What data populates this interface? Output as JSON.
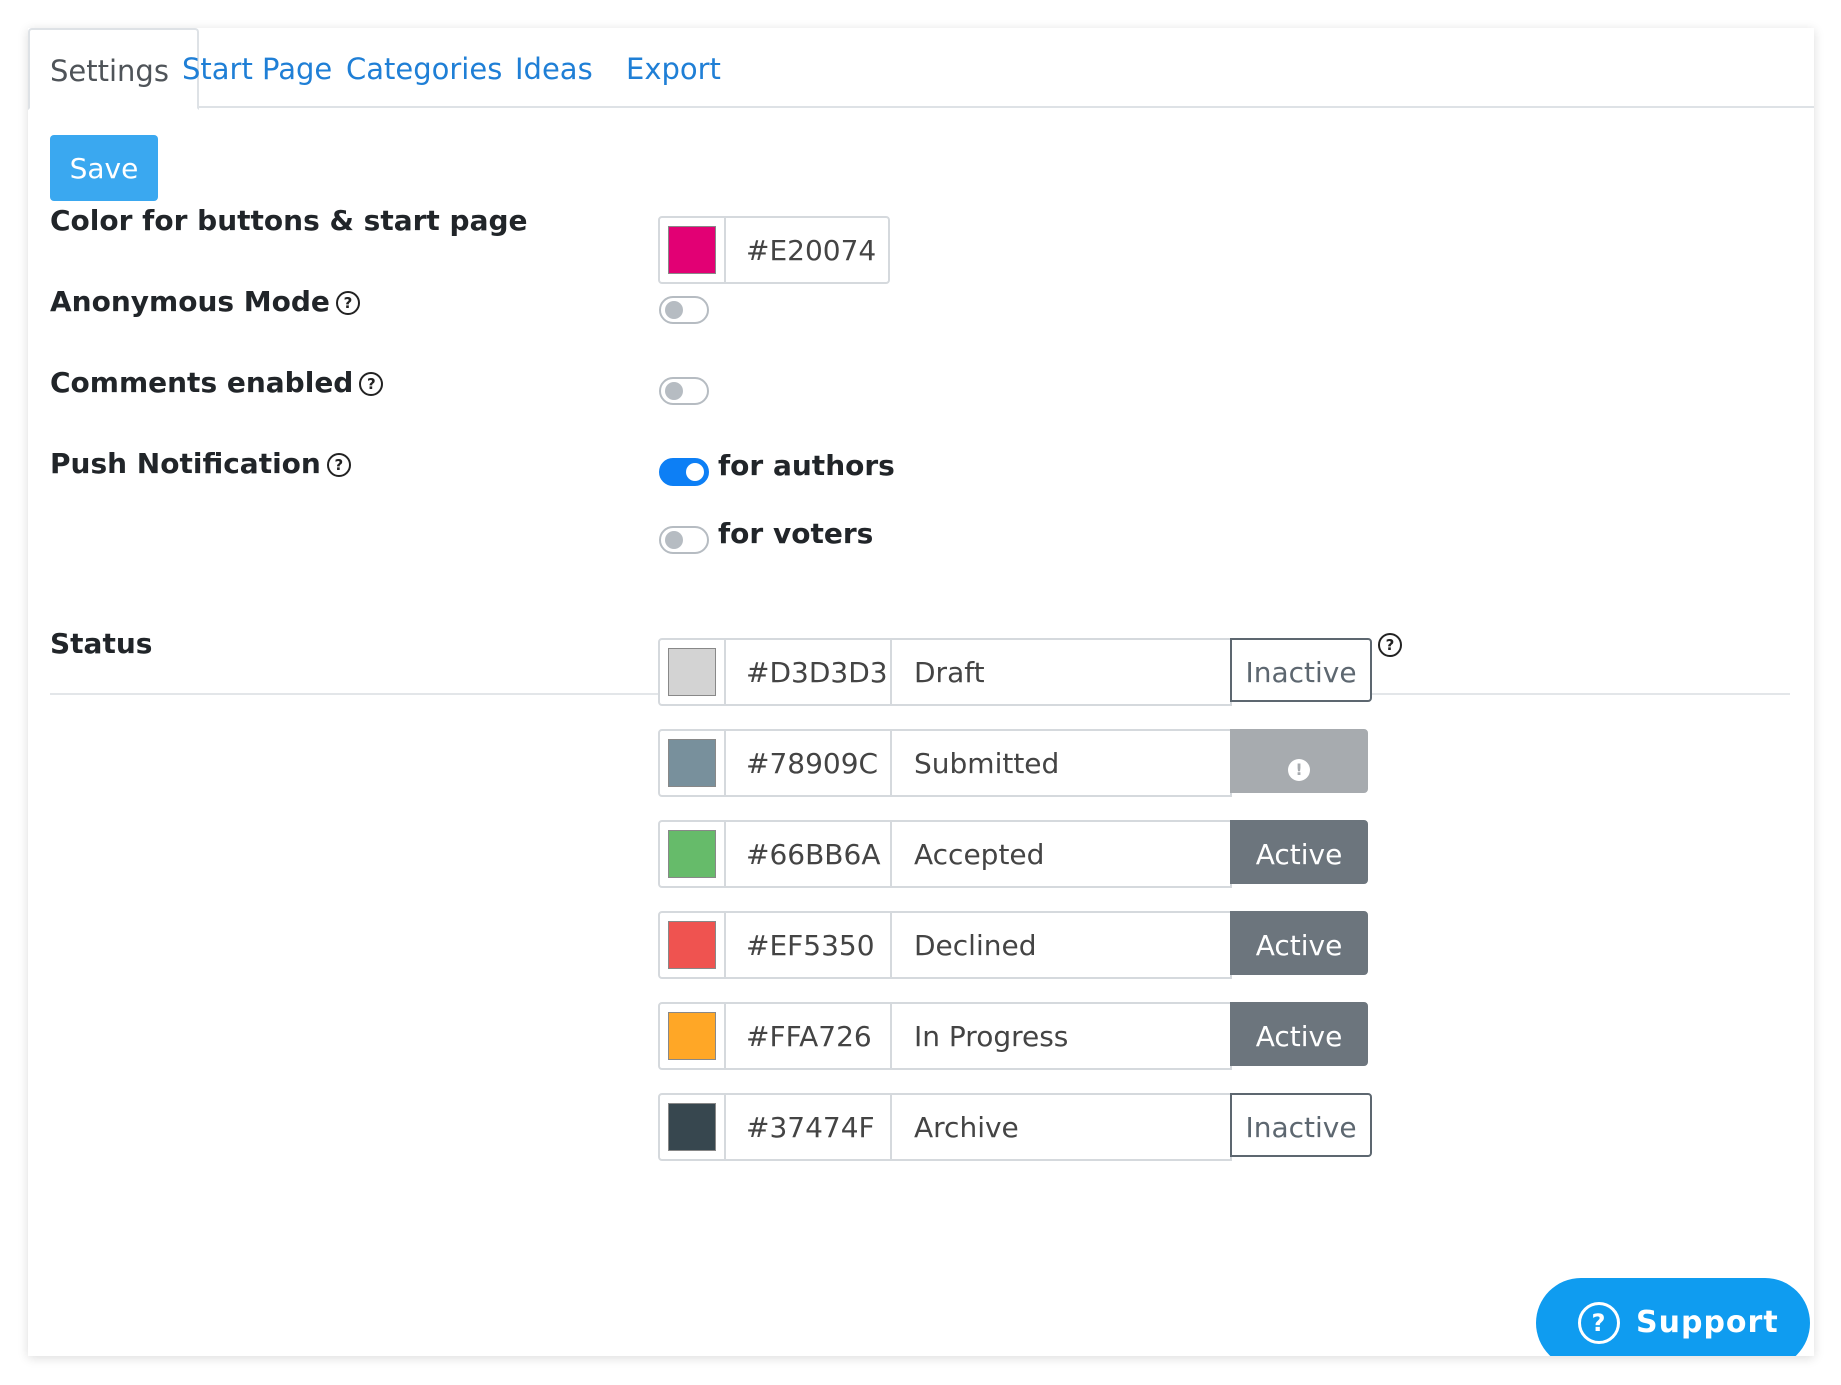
{
  "tabs": [
    {
      "label": "Settings",
      "active": true
    },
    {
      "label": "Start Page",
      "active": false
    },
    {
      "label": "Categories",
      "active": false
    },
    {
      "label": "Ideas",
      "active": false
    },
    {
      "label": "Export",
      "active": false
    }
  ],
  "toolbar": {
    "save_label": "Save"
  },
  "settings": {
    "color": {
      "label": "Color for buttons & start page",
      "value": "#E20074"
    },
    "anonymous": {
      "label": "Anonymous Mode",
      "help": "?",
      "enabled": false
    },
    "comments": {
      "label": "Comments enabled",
      "help": "?",
      "enabled": false
    },
    "push": {
      "label": "Push Notification",
      "help": "?",
      "authors": {
        "label": "for authors",
        "enabled": true
      },
      "voters": {
        "label": "for voters",
        "enabled": false
      }
    }
  },
  "status": {
    "label": "Status",
    "help": "?",
    "rows": [
      {
        "color": "#D3D3D3",
        "name": "Draft",
        "state": "Inactive"
      },
      {
        "color": "#78909C",
        "name": "Submitted",
        "state": "!"
      },
      {
        "color": "#66BB6A",
        "name": "Accepted",
        "state": "Active"
      },
      {
        "color": "#EF5350",
        "name": "Declined",
        "state": "Active"
      },
      {
        "color": "#FFA726",
        "name": "In Progress",
        "state": "Active"
      },
      {
        "color": "#37474F",
        "name": "Archive",
        "state": "Inactive"
      }
    ]
  },
  "support": {
    "label": "Support",
    "icon": "question-circle-icon",
    "icon_glyph": "?"
  },
  "colors": {
    "primary": "#1f7fd6",
    "save_button": "#3aa8f0",
    "toggle_on": "#0d7ff5",
    "active_state": "#6c757d",
    "support": "#0f9cf0"
  }
}
